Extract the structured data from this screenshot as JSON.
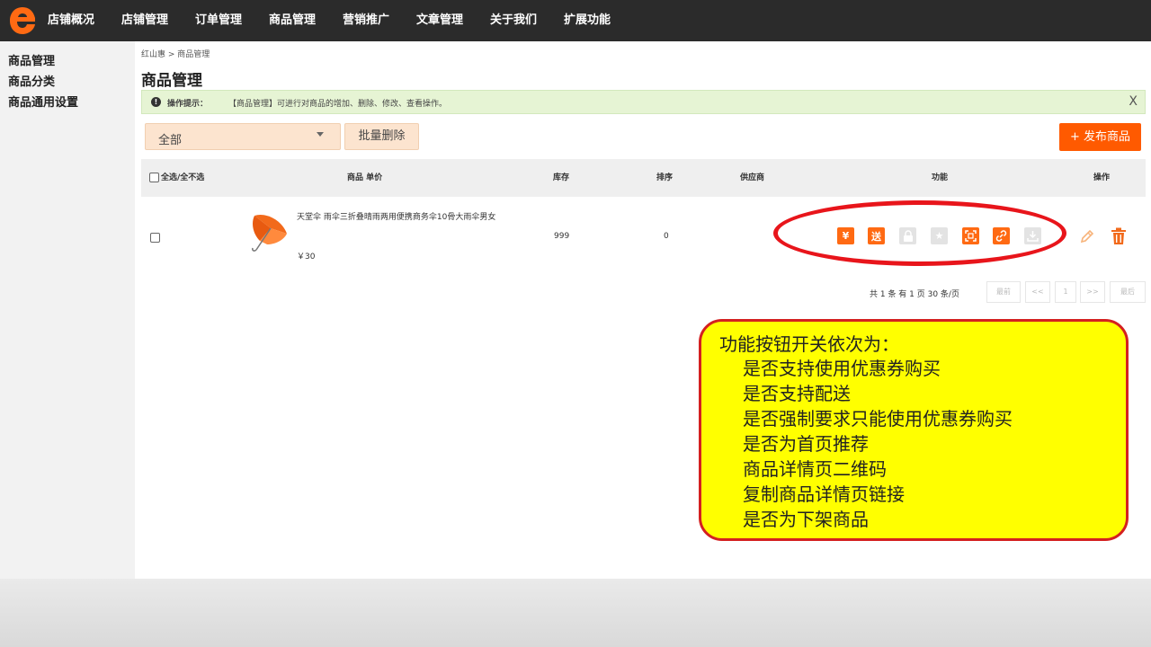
{
  "nav": {
    "items": [
      "店铺概况",
      "店铺管理",
      "订单管理",
      "商品管理",
      "营销推广",
      "文章管理",
      "关于我们",
      "扩展功能"
    ]
  },
  "sidebar": {
    "items": [
      "商品管理",
      "商品分类",
      "商品通用设置"
    ]
  },
  "breadcrumb": "红山惠 > 商品管理",
  "page_title": "商品管理",
  "tip": {
    "label": "操作提示：",
    "text": "【商品管理】可进行对商品的增加、删除、修改、查看操作。",
    "close": "X"
  },
  "toolbar": {
    "filter_value": "全部",
    "batch_delete": "批量删除",
    "publish": "+ 发布商品"
  },
  "table": {
    "headers": {
      "select_all": "全选/全不选",
      "product": "商品 单价",
      "stock": "库存",
      "sort": "排序",
      "supplier": "供应商",
      "functions": "功能",
      "actions": "操作"
    },
    "rows": [
      {
        "name": "天堂伞 雨伞三折叠晴雨两用便携商务伞10骨大雨伞男女",
        "price": "￥30",
        "stock": "999",
        "sort": "0",
        "supplier": "",
        "functions": [
          {
            "icon": "coupon-yen-icon",
            "glyph": "¥",
            "on": true
          },
          {
            "icon": "delivery-song-icon",
            "glyph": "送",
            "on": true
          },
          {
            "icon": "lock-icon",
            "glyph": "",
            "on": false
          },
          {
            "icon": "star-icon",
            "glyph": "★",
            "on": false
          },
          {
            "icon": "qrcode-icon",
            "glyph": "",
            "on": true
          },
          {
            "icon": "link-icon",
            "glyph": "",
            "on": true
          },
          {
            "icon": "download-shelf-icon",
            "glyph": "",
            "on": false
          }
        ]
      }
    ]
  },
  "pager": {
    "info": "共 1 条 有 1 页 30 条/页",
    "first": "最前",
    "prev": "<<",
    "current": "1",
    "next": ">>",
    "last": "最后"
  },
  "callout": {
    "title": "功能按钮开关依次为：",
    "lines": [
      "是否支持使用优惠券购买",
      "是否支持配送",
      "是否强制要求只能使用优惠券购买",
      "是否为首页推荐",
      "商品详情页二维码",
      "复制商品详情页链接",
      "是否为下架商品"
    ]
  },
  "colors": {
    "nav_bg": "#2b2b2b",
    "accent": "#ff5a00",
    "tip_bg": "#e6f4d4",
    "callout_bg": "#ffff00",
    "callout_border": "#d42020",
    "highlight_ellipse": "#e8151b"
  }
}
